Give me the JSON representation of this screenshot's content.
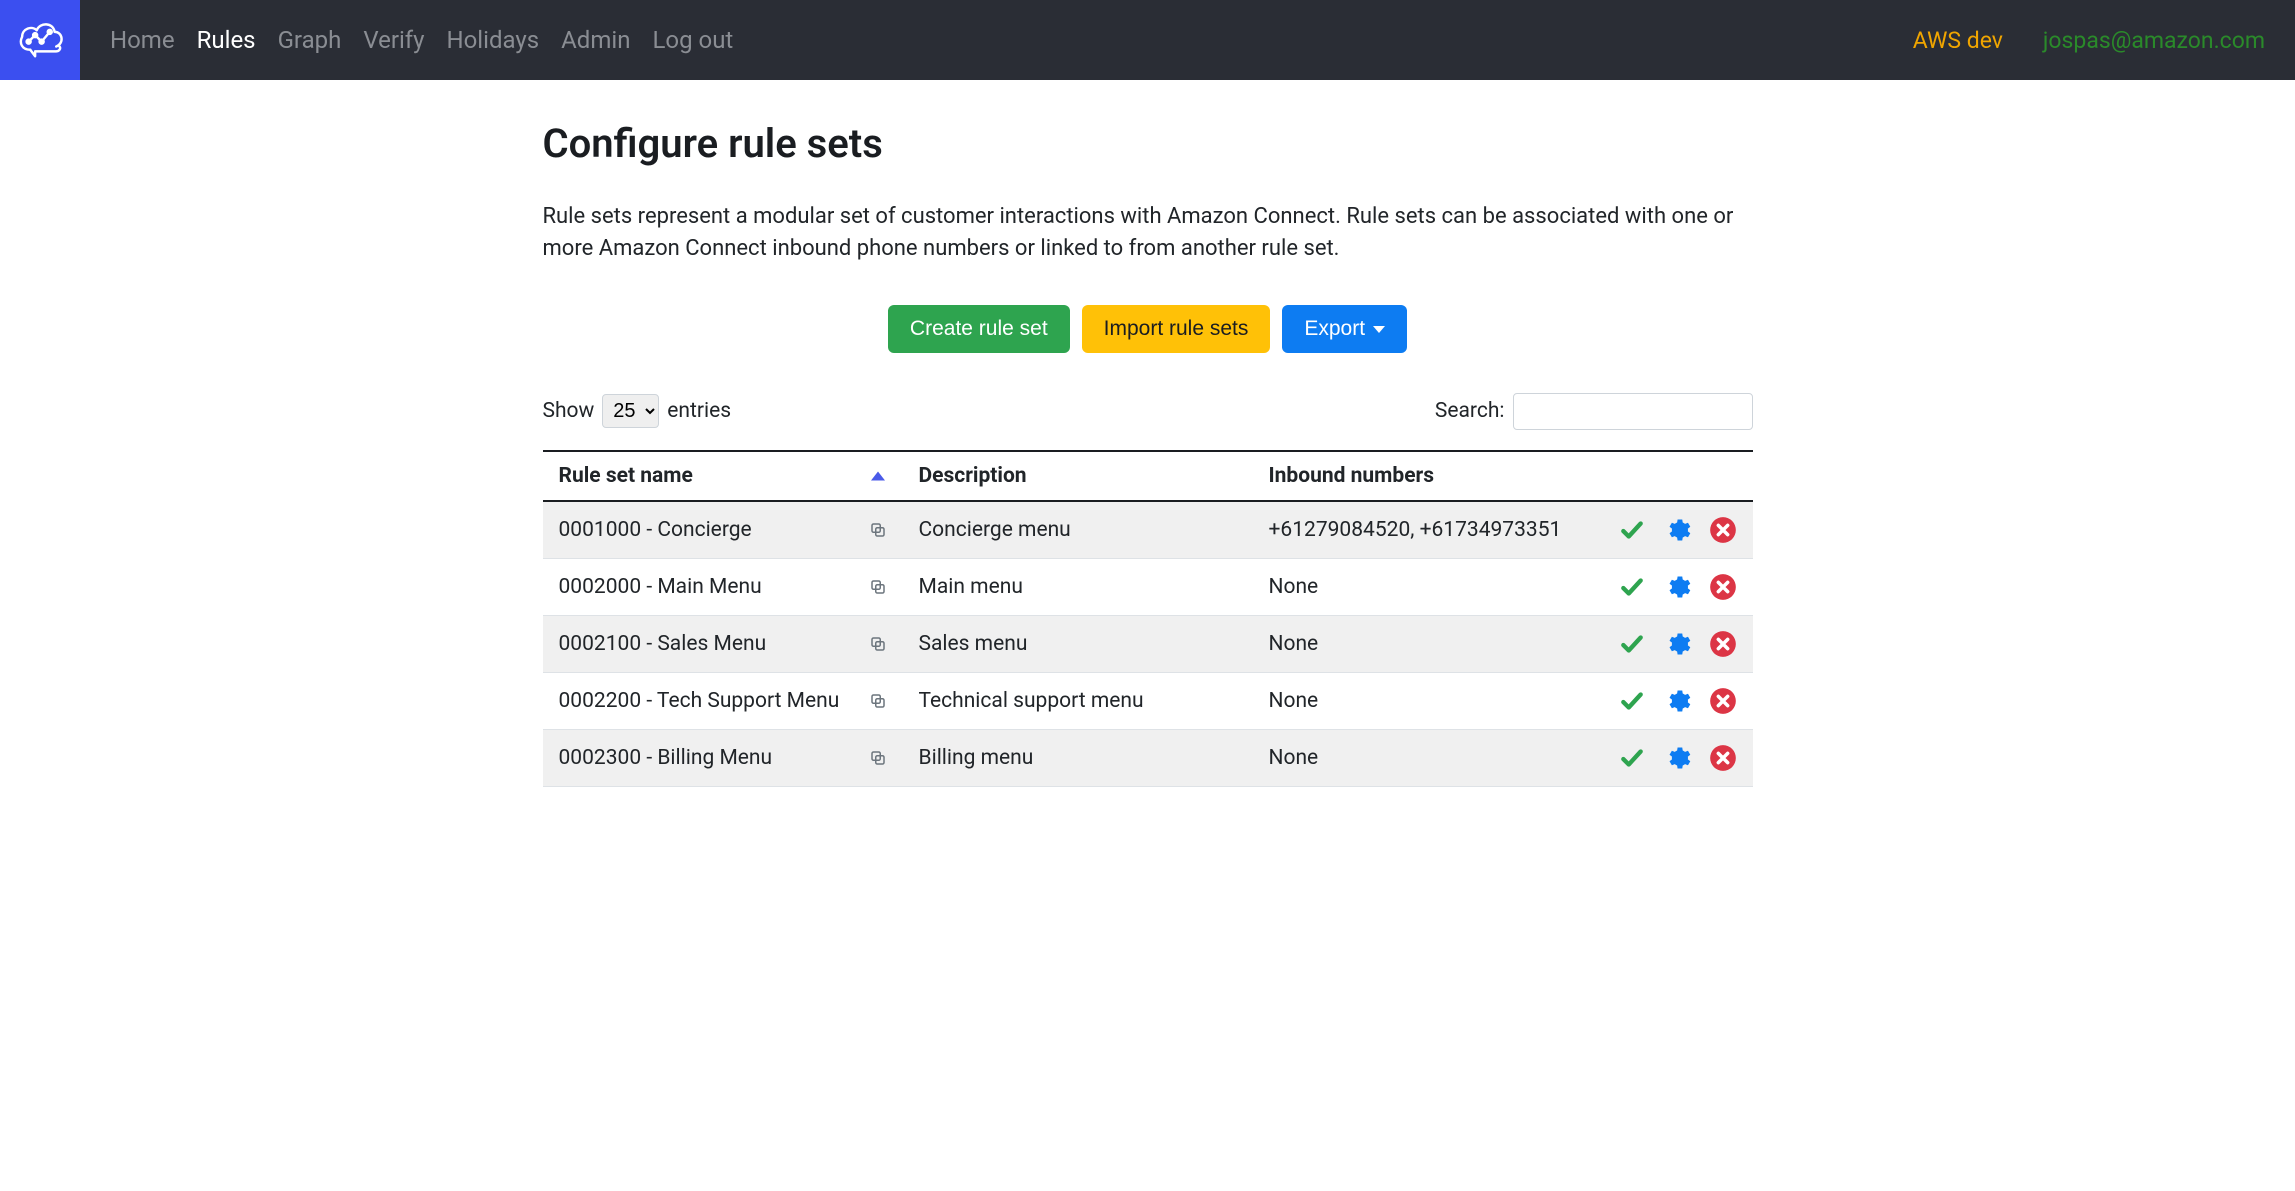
{
  "nav": {
    "items": [
      {
        "label": "Home",
        "active": false
      },
      {
        "label": "Rules",
        "active": true
      },
      {
        "label": "Graph",
        "active": false
      },
      {
        "label": "Verify",
        "active": false
      },
      {
        "label": "Holidays",
        "active": false
      },
      {
        "label": "Admin",
        "active": false
      },
      {
        "label": "Log out",
        "active": false
      }
    ],
    "env": "AWS dev",
    "user": "jospas@amazon.com"
  },
  "page": {
    "title": "Configure rule sets",
    "description": "Rule sets represent a modular set of customer interactions with Amazon Connect. Rule sets can be associated with one or more Amazon Connect inbound phone numbers or linked to from another rule set."
  },
  "buttons": {
    "create": "Create rule set",
    "import": "Import rule sets",
    "export": "Export"
  },
  "table": {
    "show_label_pre": "Show",
    "show_label_post": "entries",
    "show_value": "25",
    "search_label": "Search:",
    "columns": {
      "name": "Rule set name",
      "description": "Description",
      "inbound": "Inbound numbers"
    },
    "rows": [
      {
        "name": "0001000 - Concierge",
        "description": "Concierge menu",
        "inbound": "+61279084520, +61734973351"
      },
      {
        "name": "0002000 - Main Menu",
        "description": "Main menu",
        "inbound": "None"
      },
      {
        "name": "0002100 - Sales Menu",
        "description": "Sales menu",
        "inbound": "None"
      },
      {
        "name": "0002200 - Tech Support Menu",
        "description": "Technical support menu",
        "inbound": "None"
      },
      {
        "name": "0002300 - Billing Menu",
        "description": "Billing menu",
        "inbound": "None"
      }
    ]
  }
}
